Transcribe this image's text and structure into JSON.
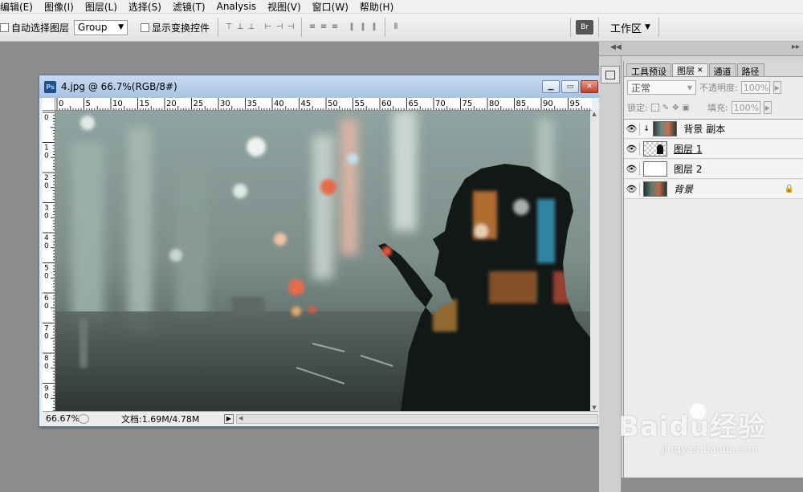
{
  "menubar": {
    "items": [
      "编辑(E)",
      "图像(I)",
      "图层(L)",
      "选择(S)",
      "滤镜(T)",
      "Analysis",
      "视图(V)",
      "窗口(W)",
      "帮助(H)"
    ]
  },
  "options": {
    "auto_select_label": "自动选择图层",
    "group_value": "Group",
    "show_transform_label": "显示变换控件",
    "workspace_label": "工作区"
  },
  "document": {
    "title": "4.jpg @ 66.7%(RGB/8#)",
    "ruler_top": [
      "0",
      "5",
      "10",
      "15",
      "20",
      "25",
      "30",
      "35",
      "40",
      "45",
      "50",
      "55",
      "60",
      "65",
      "70",
      "75",
      "80",
      "85",
      "90",
      "95"
    ],
    "ruler_left": [
      "0",
      "1\n0",
      "2\n0",
      "3\n0",
      "4\n0",
      "5\n0",
      "6\n0",
      "7\n0",
      "8\n0",
      "9\n0"
    ],
    "zoom": "66.67%",
    "doc_size": "文档:1.69M/4.78M"
  },
  "layers_panel": {
    "tabs": [
      "工具预设",
      "图层",
      "通道",
      "路径"
    ],
    "blend_mode": "正常",
    "opacity_label": "不透明度:",
    "opacity_value": "100%",
    "lock_label": "锁定:",
    "fill_label": "填充:",
    "fill_value": "100%",
    "layers": [
      {
        "name": "背景 副本"
      },
      {
        "name": "图层 1"
      },
      {
        "name": "图层 2"
      },
      {
        "name": "背景"
      }
    ]
  },
  "watermark": {
    "brand": "Baidu经验",
    "url": "jingyan.baidu.com"
  },
  "colors": {
    "titlebar": "#b5cde9",
    "accent_close": "#c0432b"
  }
}
